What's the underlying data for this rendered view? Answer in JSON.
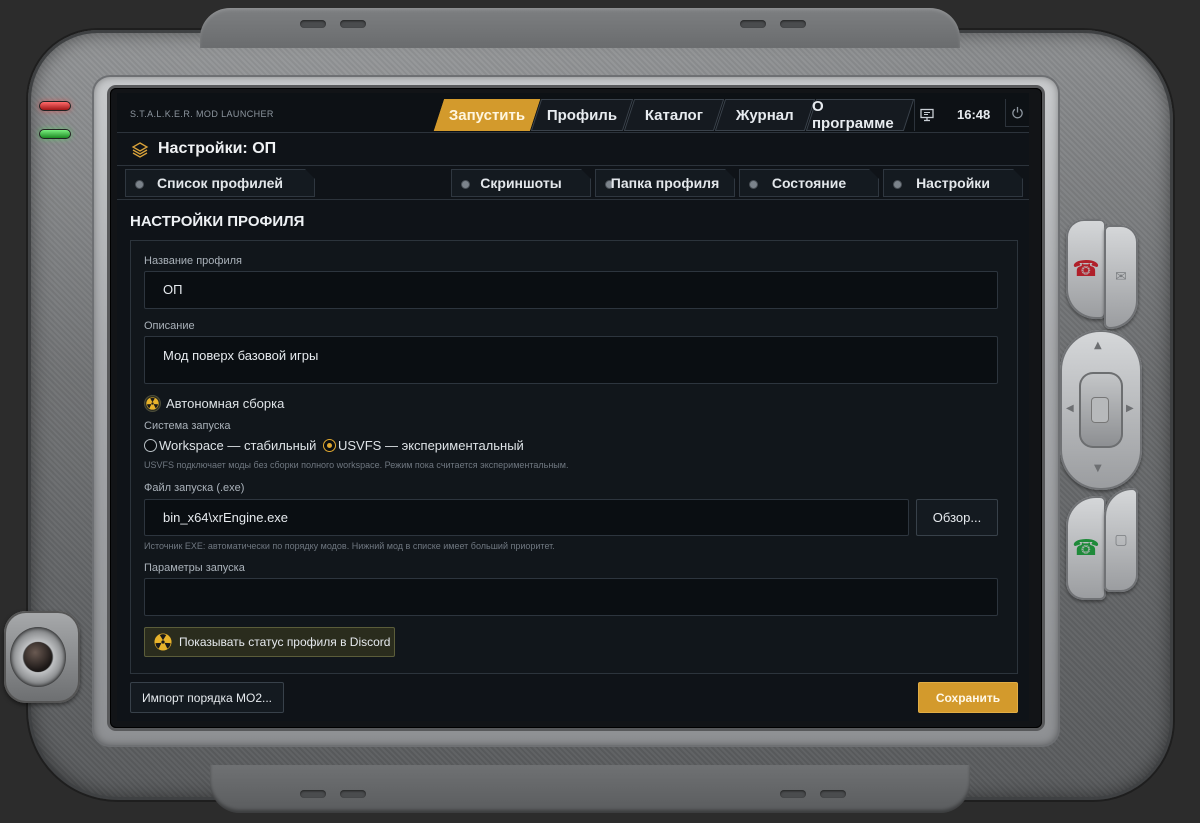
{
  "app": {
    "title": "S.T.A.L.K.E.R. MOD LAUNCHER"
  },
  "nav": [
    {
      "label": "Запустить",
      "active": true
    },
    {
      "label": "Профиль"
    },
    {
      "label": "Каталог"
    },
    {
      "label": "Журнал"
    },
    {
      "label": "О программе"
    }
  ],
  "tray": {
    "monitor_icon": "monitor-icon",
    "clock": "16:48",
    "power_icon": "power-icon"
  },
  "page": {
    "title": "Настройки: ОП",
    "icon": "layers-icon"
  },
  "tabs": [
    {
      "label": "Список профилей"
    },
    {
      "label": "Скриншоты"
    },
    {
      "label": "Папка профиля"
    },
    {
      "label": "Состояние"
    },
    {
      "label": "Настройки"
    }
  ],
  "settings": {
    "section_title": "НАСТРОЙКИ ПРОФИЛЯ",
    "profile_name": {
      "label": "Название профиля",
      "value": "ОП"
    },
    "description": {
      "label": "Описание",
      "value": "Мод поверх базовой игры"
    },
    "autonomous": {
      "label": "Автономная сборка",
      "icon": "radiation-icon"
    },
    "launch_system": {
      "label": "Система запуска",
      "options": [
        {
          "label": "Workspace — стабильный",
          "selected": false
        },
        {
          "label": "USVFS — экспериментальный",
          "selected": true
        }
      ],
      "hint": "USVFS подключает моды без сборки полного workspace. Режим пока считается экспериментальным."
    },
    "exe": {
      "label": "Файл запуска (.exe)",
      "value": "bin_x64\\xrEngine.exe",
      "browse_label": "Обзор...",
      "hint": "Источник EXE: автоматически по порядку модов. Нижний мод в списке имеет больший приоритет."
    },
    "params": {
      "label": "Параметры запуска",
      "value": ""
    },
    "discord": {
      "label": "Показывать статус профиля в Discord",
      "icon": "radiation-icon"
    }
  },
  "footer": {
    "import_label": "Импорт порядка MO2...",
    "save_label": "Сохранить"
  },
  "colors": {
    "accent": "#d39a2c",
    "background": "#0f1318",
    "led_red": "#e53935",
    "led_green": "#43d14b"
  }
}
